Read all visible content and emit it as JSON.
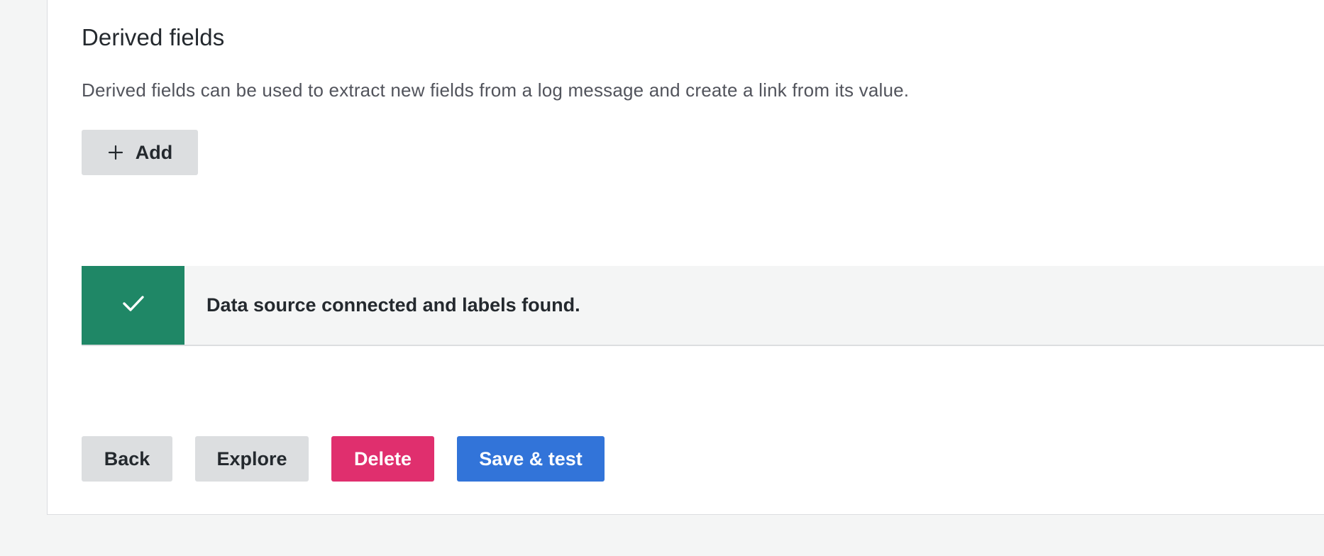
{
  "derived_fields": {
    "title": "Derived fields",
    "description": "Derived fields can be used to extract new fields from a log message and create a link from its value.",
    "add_label": "Add",
    "add_icon": "plus-icon"
  },
  "alert": {
    "status": "success",
    "icon": "check-icon",
    "message": "Data source connected and labels found.",
    "color": "#1f8766"
  },
  "actions": {
    "back_label": "Back",
    "explore_label": "Explore",
    "delete_label": "Delete",
    "save_label": "Save & test"
  },
  "colors": {
    "primary": "#3274d9",
    "danger": "#e02f6e",
    "secondary": "#dcdee0",
    "success": "#1f8766"
  }
}
